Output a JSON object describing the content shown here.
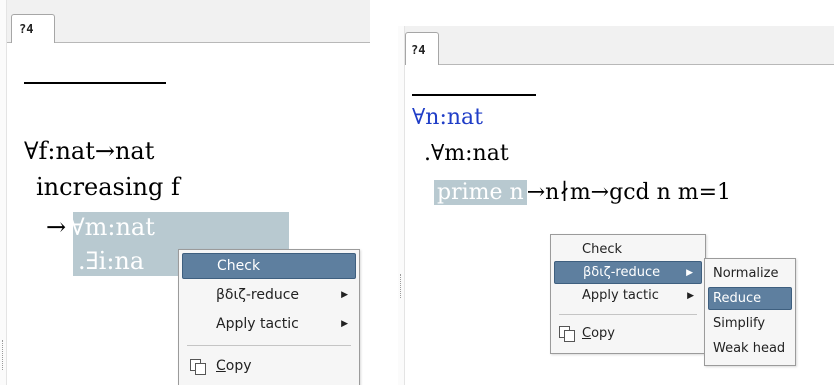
{
  "left": {
    "tab_label": "?4",
    "goal": {
      "line1": "∀f:nat→nat",
      "line2": "increasing f",
      "line3_arrow": "→",
      "line3_rest": "∀m:nat",
      "line4": ".∃i:na"
    },
    "menu": {
      "items": [
        {
          "label": "Check",
          "submenu": false,
          "selected": true
        },
        {
          "label": "βδιζ-reduce",
          "submenu": true,
          "selected": false
        },
        {
          "label": "Apply tactic",
          "submenu": true,
          "selected": false
        }
      ],
      "copy_label": "Copy",
      "copy_mnemonic": "C",
      "copy_rest": "opy"
    }
  },
  "right": {
    "tab_label": "?4",
    "goal": {
      "line1": "∀n:nat",
      "line2": ".∀m:nat",
      "line3_selected": "prime n",
      "line3_rest": "→n∤m→gcd n m=1"
    },
    "menu": {
      "items": [
        {
          "label": "Check",
          "submenu": false,
          "selected": false
        },
        {
          "label": "βδιζ-reduce",
          "submenu": true,
          "selected": true
        },
        {
          "label": "Apply tactic",
          "submenu": true,
          "selected": false
        }
      ],
      "copy_label": "Copy",
      "copy_mnemonic": "C",
      "copy_rest": "opy"
    },
    "submenu": {
      "items": [
        {
          "label": "Normalize",
          "selected": false
        },
        {
          "label": "Reduce",
          "selected": true
        },
        {
          "label": "Simplify",
          "selected": false
        },
        {
          "label": "Weak head",
          "selected": false
        }
      ]
    }
  },
  "colors": {
    "selection_background": "#b8c9d0",
    "menu_highlight": "#5e7f9f",
    "quantifier_blue": "#1f3dc7"
  }
}
